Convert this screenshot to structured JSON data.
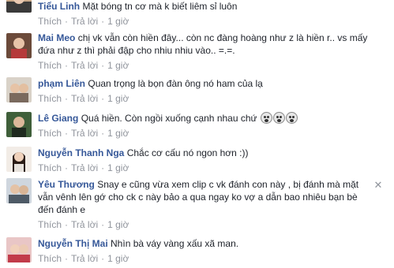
{
  "ui": {
    "like_label": "Thích",
    "reply_label": "Trả lời",
    "separator": "·",
    "close_symbol": "✕"
  },
  "comments": [
    {
      "author": "Tiểu Linh",
      "text": "Mặt bóng tn cơ mà k biết liêm sỉ luôn",
      "time": "1 giờ"
    },
    {
      "author": "Mai Meo",
      "text": "chị vk vẫn còn hiền đây... còn nc đàng hoàng như z là hiền r.. vs mấy đứa như z thì phải đập cho nhiu nhiu vào.. =.=.",
      "time": "1 giờ"
    },
    {
      "author": "phạm Liên",
      "text": "Quan trọng là bọn đàn ông nó ham của lạ",
      "time": "1 giờ"
    },
    {
      "author": "Lê Giang",
      "text": "Quá hiền. Còn ngồi xuống cạnh nhau chứ",
      "time": "1 giờ"
    },
    {
      "author": "Nguyễn Thanh Nga",
      "text": "Chắc cơ cấu nó ngon hơn :))",
      "time": "1 giờ"
    },
    {
      "author": "Yêu Thương",
      "text": "Snay e cũng vừa xem clip c vk đánh con này , bị đánh mà mặt vẫn vênh lên gớ cho ck c này bảo a qua ngay ko vợ a dẫn bao nhiêu bạn bè đến đánh e",
      "time": "1 giờ"
    },
    {
      "author": "Nguyễn Thị Mai",
      "text": "Nhìn bà váy vàng xấu xã man.",
      "time": "1 giờ"
    }
  ]
}
